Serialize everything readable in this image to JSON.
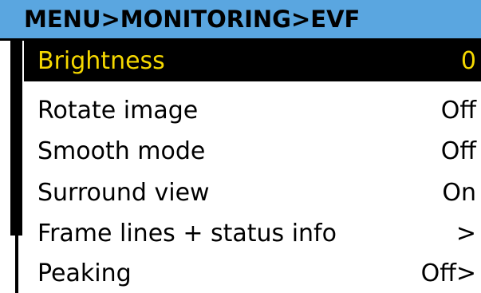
{
  "header": {
    "title": "MENU>MONITORING>EVF"
  },
  "menu": {
    "items": [
      {
        "label": "Brightness",
        "value": "0"
      },
      {
        "label": "Rotate image",
        "value": "Off"
      },
      {
        "label": "Smooth mode",
        "value": "Off"
      },
      {
        "label": "Surround view",
        "value": "On"
      },
      {
        "label": "Frame lines + status info",
        "value": ">"
      },
      {
        "label": "Peaking",
        "value": "Off>"
      }
    ],
    "selected_index": 0
  },
  "colors": {
    "header_bg": "#5aa6e0",
    "selected_bg": "#000000",
    "selected_text": "#f5d800",
    "text": "#000000",
    "background": "#ffffff"
  }
}
